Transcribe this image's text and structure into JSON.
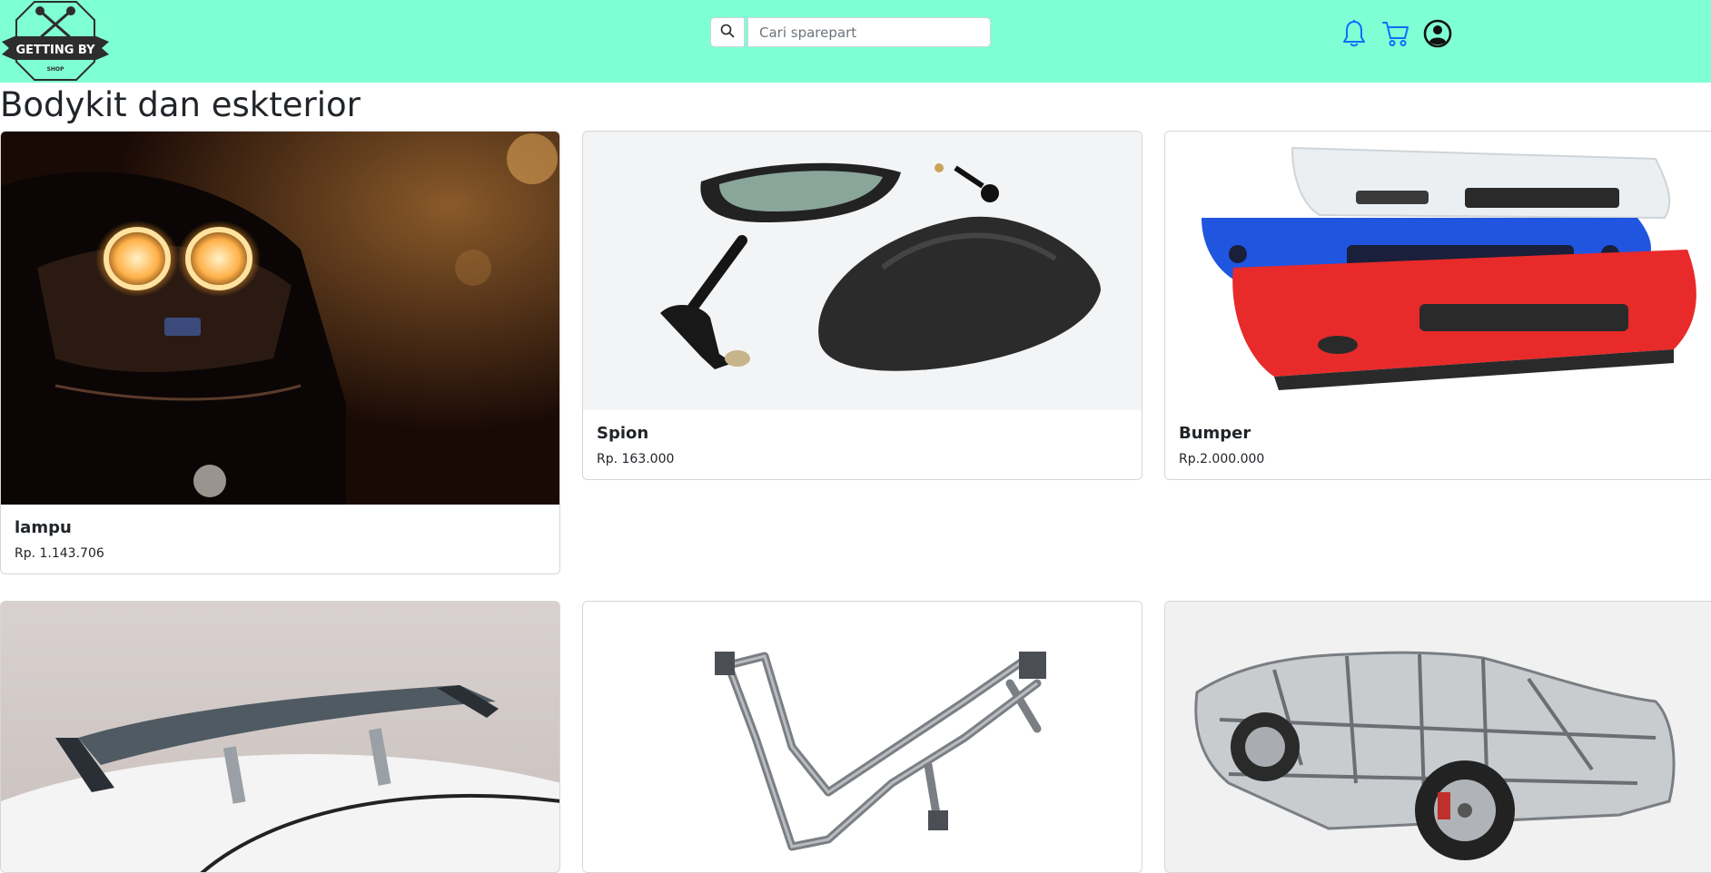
{
  "brand": {
    "logo_text": "GETTING BY",
    "logo_subtext": "SHOP"
  },
  "search": {
    "placeholder": "Cari sparepart",
    "value": ""
  },
  "nav": {
    "icons": [
      "bell-icon",
      "cart-icon",
      "user-circle-icon"
    ],
    "icon_color": "#0d6efd"
  },
  "colors": {
    "navbar_bg": "#7fffd4",
    "text": "#212529"
  },
  "page": {
    "title": "Bodykit dan eskterior"
  },
  "products": [
    {
      "name": "lampu",
      "price": "Rp. 1.143.706",
      "image": "car-headlight"
    },
    {
      "name": "Spion",
      "price": "Rp. 163.000",
      "image": "side-mirror"
    },
    {
      "name": "Bumper",
      "price": "Rp.2.000.000",
      "image": "bumpers"
    },
    {
      "name": "",
      "price": "",
      "image": "rear-spoiler"
    },
    {
      "name": "",
      "price": "",
      "image": "motorcycle-frame"
    },
    {
      "name": "",
      "price": "",
      "image": "car-body-frame"
    }
  ]
}
